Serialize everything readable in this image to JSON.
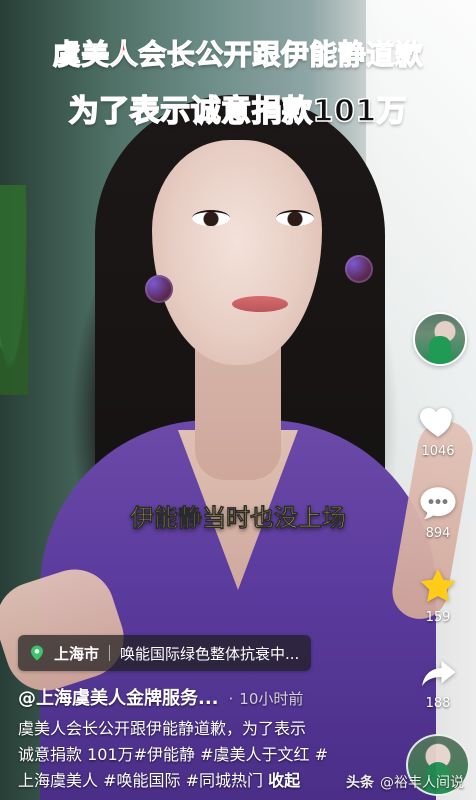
{
  "captions": {
    "top_line1": "虞美人会长公开跟伊能静道歉",
    "top_line2": "为了表示诚意捐款101万",
    "subtitle": "伊能静当时也没上场"
  },
  "rail": {
    "like_count": "1046",
    "comment_count": "894",
    "favorite_count": "159",
    "share_count": "188"
  },
  "location": {
    "city": "上海市",
    "poi": "唤能国际绿色整体抗衰中..."
  },
  "author": {
    "handle": "@上海虞美人金牌服务...",
    "time": "10小时前",
    "time_dot": "·"
  },
  "description": {
    "lines": [
      "虞美人会长公开跟伊能静道歉，为了表示",
      "诚意捐款 101万#伊能静 #虞美人于文红 #",
      "上海虞美人 #唤能国际 #同城热门",
      "收起"
    ]
  },
  "watermark": {
    "app": "头条",
    "account": "@裕丰人间说"
  },
  "colors": {
    "caption_red": "#ff3b48",
    "subtitle_yellow": "#f8e15a",
    "favorite_star": "#ffcc17",
    "white": "#ffffff"
  },
  "icons": {
    "like": "heart-icon",
    "comment": "comment-bubble-icon",
    "favorite": "star-icon",
    "share": "share-arrow-icon",
    "location": "location-pin-icon"
  }
}
